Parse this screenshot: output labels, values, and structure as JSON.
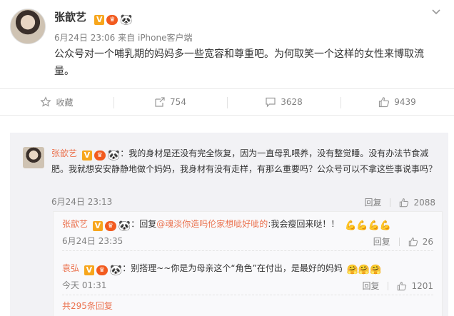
{
  "post": {
    "author": "张歆艺",
    "date": "6月24日 23:06",
    "source_prefix": "来自",
    "source": "iPhone客户端",
    "text": "公众号对一个哺乳期的妈妈多一些宽容和尊重吧。为何取笑一个这样的女性来博取流量。"
  },
  "actions": {
    "favorite": "收藏",
    "repost": "754",
    "comment": "3628",
    "like": "9439"
  },
  "comment1": {
    "author": "张歆艺",
    "text": "：我的身材是还没有完全恢复，因为一直母乳喂养，没有整觉睡。没有办法节食减肥。我就想安安静静地做个妈妈，我身材有没有走样，有那么重要吗？公众号可以不拿这些事说事吗？",
    "time": "6月24日 23:13",
    "reply_label": "回复",
    "likes": "2088"
  },
  "reply1": {
    "author": "张歆艺",
    "prefix": "：回复",
    "mention": "@魂淡你造吗伦家想呲好呲的",
    "text": ":我会瘦回来哒！！",
    "time": "6月24日 23:35",
    "reply_label": "回复",
    "likes": "26"
  },
  "reply2": {
    "author": "袁弘",
    "text": "：别搭理~~你是为母亲这个“角色”在付出，是最好的妈妈",
    "time": "今天 01:31",
    "reply_label": "回复",
    "likes": "1201"
  },
  "more_replies": "共295条回复",
  "badges": {
    "v": "V",
    "crown": "♛",
    "panda": "🐼"
  },
  "colors": {
    "accent": "#eb7350",
    "vip_orange": "#f7a61c",
    "meta_gray": "#808080"
  }
}
